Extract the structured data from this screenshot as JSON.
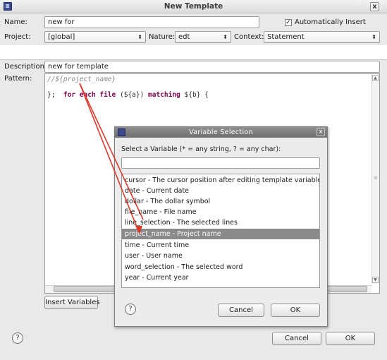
{
  "window": {
    "title": "New Template",
    "close_glyph": "x",
    "icon": "template-app-icon"
  },
  "form": {
    "name_label": "Name:",
    "name_value": "new for",
    "auto_insert_label": "Automatically Insert",
    "auto_insert_checked": true,
    "project_label": "Project:",
    "project_value": "[global]",
    "nature_label": "Nature:",
    "nature_value": "edt",
    "context_label": "Context:",
    "context_value": "Statement",
    "description_label": "Description:",
    "description_value": "new for template",
    "pattern_label": "Pattern:"
  },
  "pattern": {
    "comment": "//${project_name}",
    "line2_keyword": "for each file",
    "line2_var_a": " (${a})",
    "line2_matching": " matching",
    "line2_rest": " ${b} {",
    "line3": "};"
  },
  "buttons": {
    "insert_variables": "Insert Variables",
    "cancel": "Cancel",
    "ok": "OK",
    "help_glyph": "?"
  },
  "dialog": {
    "title": "Variable Selection",
    "close_glyph": "x",
    "prompt": "Select a Variable (* = any string, ? = any char):",
    "filter_value": "",
    "items": [
      {
        "label": "cursor - The cursor position after editing template variables",
        "selected": false
      },
      {
        "label": "date - Current date",
        "selected": false
      },
      {
        "label": "dollar - The dollar symbol",
        "selected": false
      },
      {
        "label": "file_name - File name",
        "selected": false
      },
      {
        "label": "line_selection - The selected lines",
        "selected": false
      },
      {
        "label": "project_name - Project name",
        "selected": true
      },
      {
        "label": "time - Current time",
        "selected": false
      },
      {
        "label": "user - User name",
        "selected": false
      },
      {
        "label": "word_selection - The selected word",
        "selected": false
      },
      {
        "label": "year - Current year",
        "selected": false
      }
    ],
    "cancel": "Cancel",
    "ok": "OK",
    "help_glyph": "?"
  },
  "colors": {
    "keyword": "#7f0055",
    "comment": "#8a8a8a",
    "selection": "#8a8a8a",
    "annotation_arrow": "#d93a2b"
  }
}
